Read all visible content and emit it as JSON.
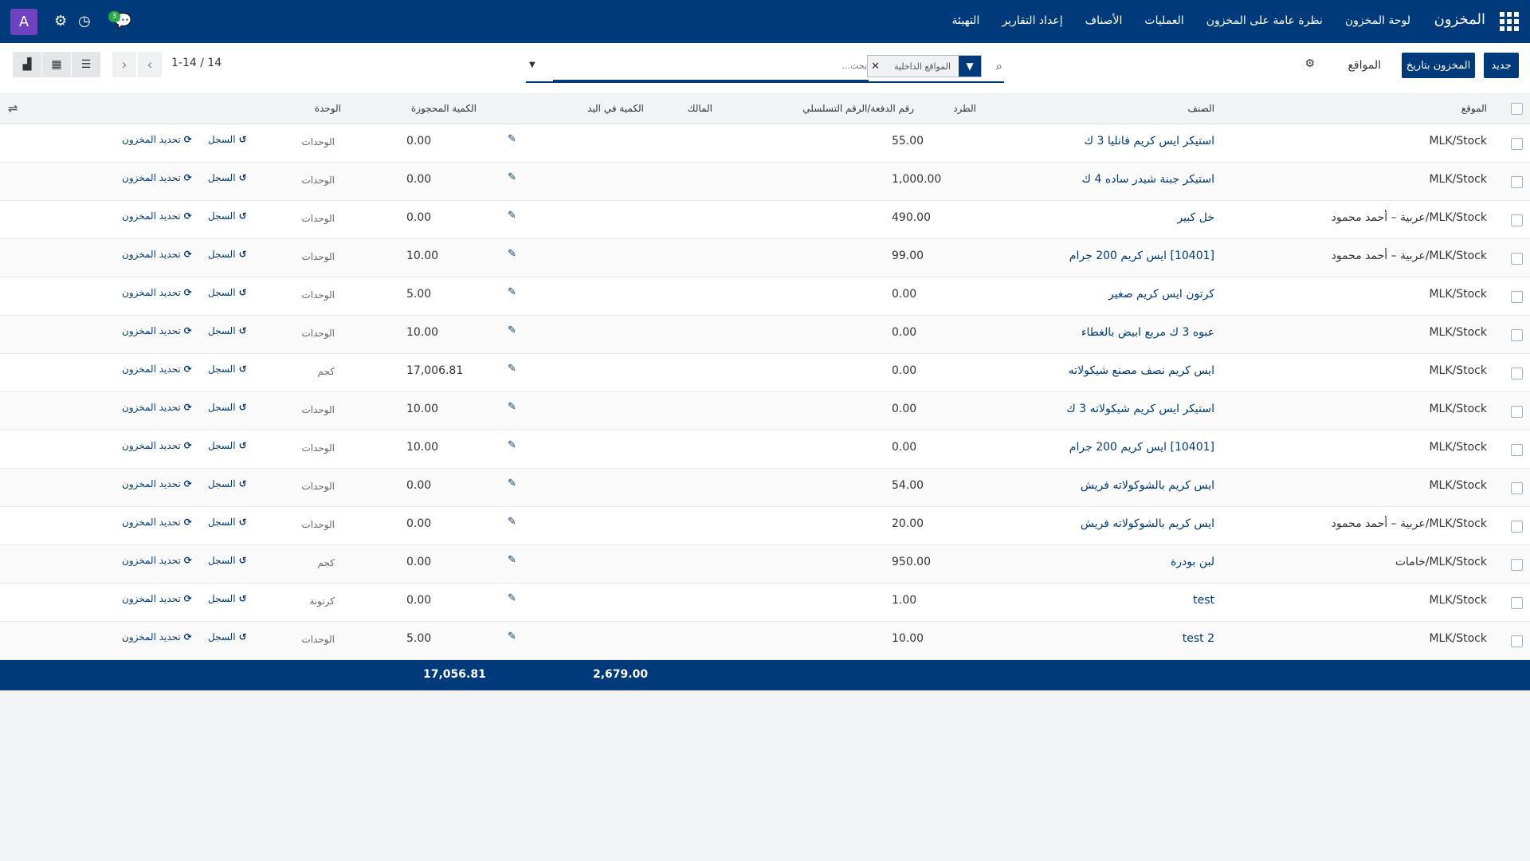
{
  "navbar": {
    "brand": "المخزون",
    "menu": [
      "لوحة المخزون",
      "نظرة عامة على المخزون",
      "العمليات",
      "الأصناف",
      "إعداد التقارير",
      "التهيئة"
    ],
    "avatar": "A",
    "badge": "3"
  },
  "control": {
    "new_btn": "جديد",
    "date_btn": "المخزون بتاريخ",
    "locations_label": "المواقع",
    "search_facet": "المواقع الداخلية",
    "search_placeholder": "بحث...",
    "pager": "1-14 / 14"
  },
  "columns": {
    "location": "الموقع",
    "product": "الصنف",
    "package": "الطرد",
    "lot": "رقم الدفعة/الرقم التسلسلي",
    "owner": "المالك",
    "on_hand": "الكمية في اليد",
    "reserved": "الكمية المحجوزة",
    "uom": "الوحدة"
  },
  "row_actions": {
    "history": "السجل",
    "replenish": "تحديد المخزون"
  },
  "rows": [
    {
      "location": "MLK/Stock",
      "product": "استيكر ايس كريم فانليا 3 ك",
      "on_hand": "55.00",
      "reserved": "0.00",
      "uom": "الوحدات"
    },
    {
      "location": "MLK/Stock",
      "product": "استيكر جبنة شيدر ساده 4 ك",
      "on_hand": "1,000.00",
      "reserved": "0.00",
      "uom": "الوحدات"
    },
    {
      "location": "MLK/Stock/عربية – أحمد محمود",
      "product": "خل كبير",
      "on_hand": "490.00",
      "reserved": "0.00",
      "uom": "الوحدات"
    },
    {
      "location": "MLK/Stock/عربية – أحمد محمود",
      "product": "[10401] ايس كريم 200 جرام",
      "on_hand": "99.00",
      "reserved": "10.00",
      "uom": "الوحدات"
    },
    {
      "location": "MLK/Stock",
      "product": "كرتون ايس كريم صغير",
      "on_hand": "0.00",
      "reserved": "5.00",
      "uom": "الوحدات"
    },
    {
      "location": "MLK/Stock",
      "product": "عبوه 3 ك مربع ابيض بالغطاء",
      "on_hand": "0.00",
      "reserved": "10.00",
      "uom": "الوحدات"
    },
    {
      "location": "MLK/Stock",
      "product": "ايس كريم نصف مصنع شيكولاته",
      "on_hand": "0.00",
      "reserved": "17,006.81",
      "uom": "كجم"
    },
    {
      "location": "MLK/Stock",
      "product": "استيكر ايس كريم شيكولاته 3 ك",
      "on_hand": "0.00",
      "reserved": "10.00",
      "uom": "الوحدات"
    },
    {
      "location": "MLK/Stock",
      "product": "[10401] ايس كريم 200 جرام",
      "on_hand": "0.00",
      "reserved": "10.00",
      "uom": "الوحدات"
    },
    {
      "location": "MLK/Stock",
      "product": "ايس كريم بالشوكولاته فريش",
      "on_hand": "54.00",
      "reserved": "0.00",
      "uom": "الوحدات"
    },
    {
      "location": "MLK/Stock/عربية – أحمد محمود",
      "product": "ايس كريم بالشوكولاته فريش",
      "on_hand": "20.00",
      "reserved": "0.00",
      "uom": "الوحدات"
    },
    {
      "location": "MLK/Stock/خامات",
      "product": "لبن بودرة",
      "on_hand": "950.00",
      "reserved": "0.00",
      "uom": "كجم"
    },
    {
      "location": "MLK/Stock",
      "product": "test",
      "on_hand": "1.00",
      "reserved": "0.00",
      "uom": "كرتونة"
    },
    {
      "location": "MLK/Stock",
      "product": "test 2",
      "on_hand": "10.00",
      "reserved": "5.00",
      "uom": "الوحدات"
    }
  ],
  "totals": {
    "on_hand": "2,679.00",
    "reserved": "17,056.81"
  }
}
